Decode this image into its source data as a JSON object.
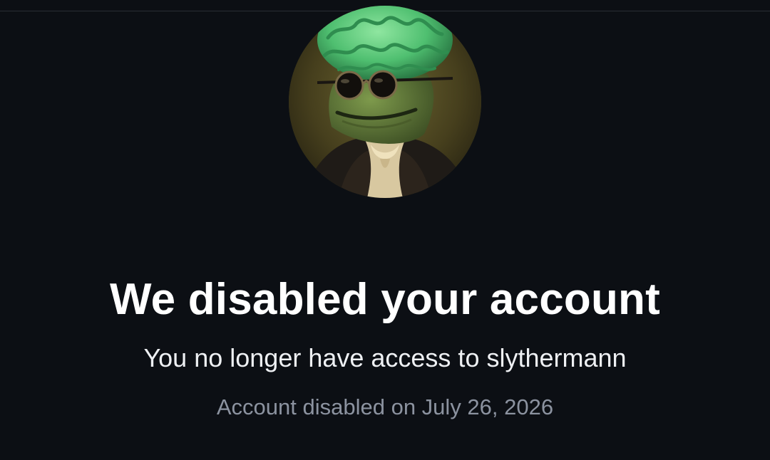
{
  "notice": {
    "title": "We disabled your account",
    "subtitle": "You no longer have access to slythermann",
    "disabled_note": "Account disabled on July 26, 2026"
  },
  "avatar": {
    "icon": "profile-avatar-frog-portrait"
  }
}
